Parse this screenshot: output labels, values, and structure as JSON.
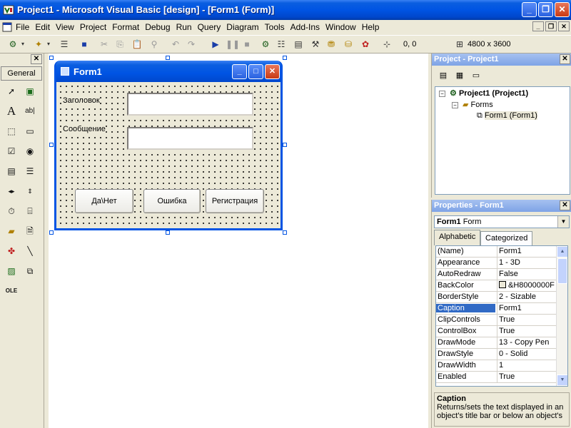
{
  "window": {
    "title": "Project1 - Microsoft Visual Basic [design] - [Form1 (Form)]"
  },
  "menu": [
    "File",
    "Edit",
    "View",
    "Project",
    "Format",
    "Debug",
    "Run",
    "Query",
    "Diagram",
    "Tools",
    "Add-Ins",
    "Window",
    "Help"
  ],
  "toolbar": {
    "coords": "0, 0",
    "size": "4800 x 3600"
  },
  "toolbox": {
    "tab": "General",
    "close": "✕"
  },
  "form": {
    "title": "Form1",
    "label_title": "Заголовок",
    "label_message": "Сообщение",
    "btn_yesno": "Да\\Нет",
    "btn_error": "Ошибка",
    "btn_register": "Регистрация"
  },
  "project": {
    "title": "Project - Project1",
    "root": "Project1 (Project1)",
    "folder": "Forms",
    "form_item": "Form1 (Form1)"
  },
  "properties": {
    "title": "Properties - Form1",
    "object_name": "Form1",
    "object_type": "Form",
    "tab_alpha": "Alphabetic",
    "tab_cat": "Categorized",
    "rows": [
      {
        "name": "(Name)",
        "value": "Form1"
      },
      {
        "name": "Appearance",
        "value": "1 - 3D"
      },
      {
        "name": "AutoRedraw",
        "value": "False"
      },
      {
        "name": "BackColor",
        "value": "&H8000000F"
      },
      {
        "name": "BorderStyle",
        "value": "2 - Sizable"
      },
      {
        "name": "Caption",
        "value": "Form1"
      },
      {
        "name": "ClipControls",
        "value": "True"
      },
      {
        "name": "ControlBox",
        "value": "True"
      },
      {
        "name": "DrawMode",
        "value": "13 - Copy Pen"
      },
      {
        "name": "DrawStyle",
        "value": "0 - Solid"
      },
      {
        "name": "DrawWidth",
        "value": "1"
      },
      {
        "name": "Enabled",
        "value": "True"
      }
    ],
    "desc_title": "Caption",
    "desc_text": "Returns/sets the text displayed in an object's title bar or below an object's"
  }
}
